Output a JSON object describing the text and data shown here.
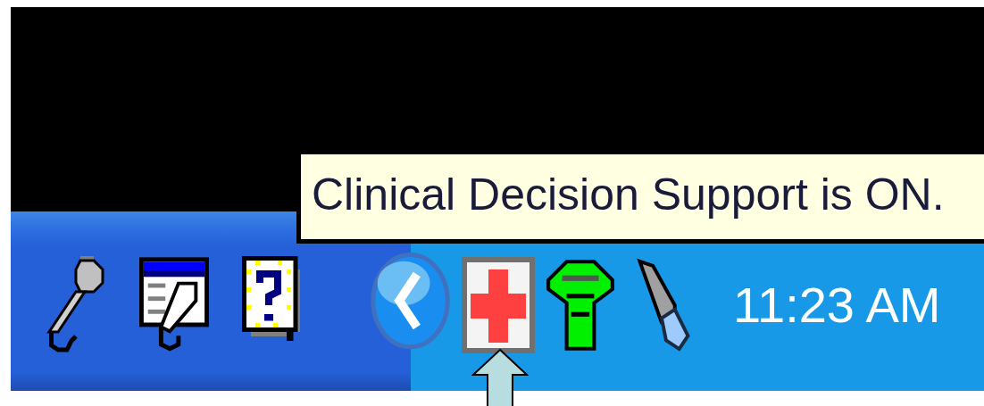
{
  "tooltip": {
    "text": "Clinical Decision Support is ON."
  },
  "tray": {
    "clock": "11:23 AM"
  }
}
